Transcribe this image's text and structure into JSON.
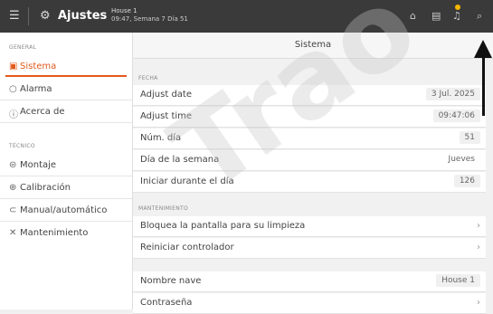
{
  "topbar": {
    "title": "Ajustes",
    "house": "House 1",
    "datetime": "09:47, Semana 7 Día 51"
  },
  "sidebar": {
    "general_label": "GENERAL",
    "tecnico_label": "TÉCNICO",
    "items": [
      {
        "label": "Sistema",
        "icon": "system-icon"
      },
      {
        "label": "Alarma",
        "icon": "alarm-icon"
      },
      {
        "label": "Acerca de",
        "icon": "info-icon"
      },
      {
        "label": "Montaje",
        "icon": "montaje-icon"
      },
      {
        "label": "Calibración",
        "icon": "calibration-icon"
      },
      {
        "label": "Manual/automático",
        "icon": "manual-auto-icon"
      },
      {
        "label": "Mantenimiento",
        "icon": "maintenance-icon"
      }
    ]
  },
  "main": {
    "title": "Sistema",
    "fecha_label": "FECHA",
    "mant_label": "MANTENIMIENTO",
    "rows": [
      {
        "label": "Adjust date",
        "value": "3 Jul. 2025"
      },
      {
        "label": "Adjust time",
        "value": "09:47:06"
      },
      {
        "label": "Núm. día",
        "value": "51"
      },
      {
        "label": "Día de la semana",
        "value": "Jueves"
      },
      {
        "label": "Iniciar durante el día",
        "value": "126"
      },
      {
        "label": "Bloquea la pantalla para su limpieza",
        "value": ""
      },
      {
        "label": "Reiniciar controlador",
        "value": ""
      },
      {
        "label": "Nombre nave",
        "value": "House 1"
      },
      {
        "label": "Contraseña",
        "value": ""
      }
    ]
  },
  "watermark": "Trao",
  "colors": {
    "accent": "#e25a1c",
    "topbar": "#3a3a3a",
    "notification": "#f5b800"
  }
}
